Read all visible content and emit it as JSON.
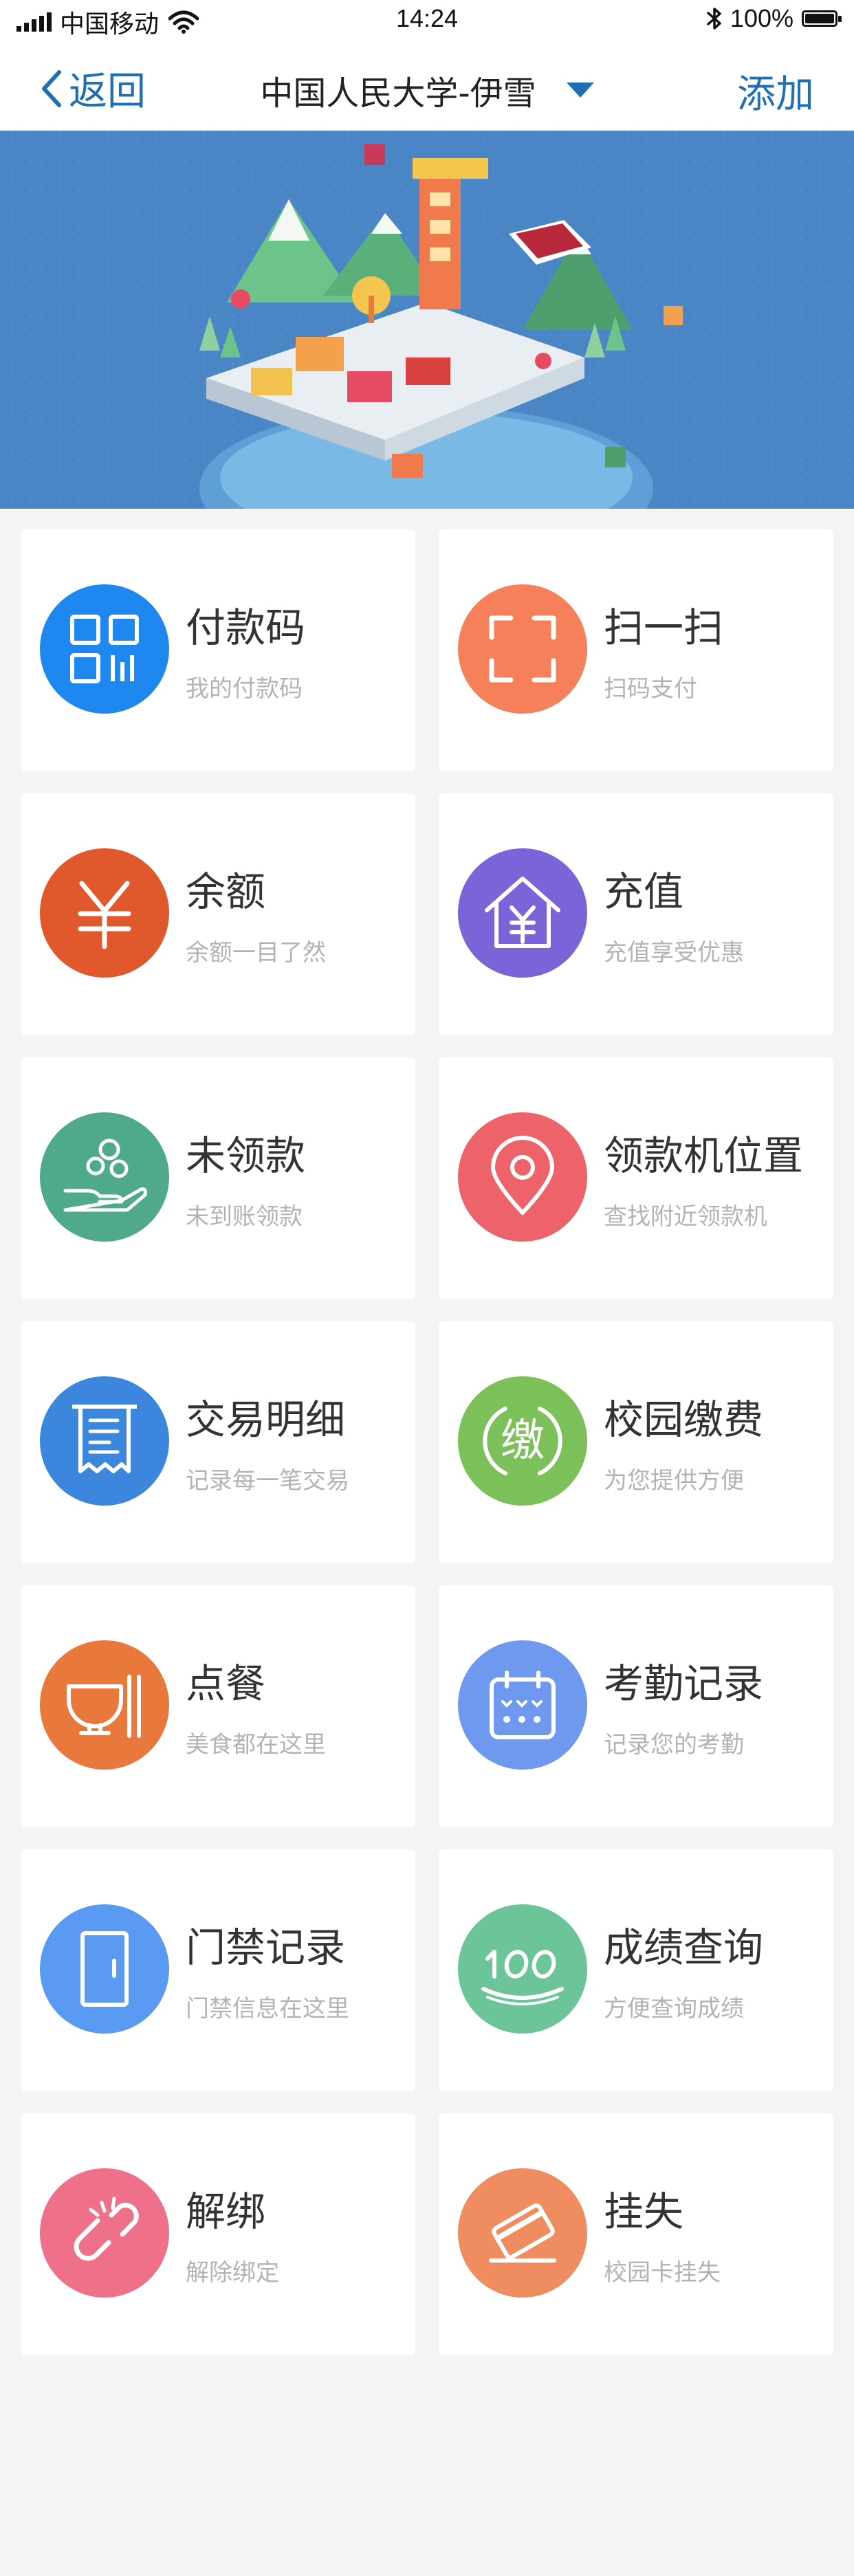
{
  "status_bar": {
    "carrier": "中国移动",
    "time": "14:24",
    "battery": "100%",
    "battery_level": 1.0
  },
  "nav": {
    "back_label": "返回",
    "title": "中国人民大学-伊雪",
    "add_label": "添加"
  },
  "colors": {
    "accent": "#1f6fb3",
    "banner_bg": "#4a86c6"
  },
  "services": [
    {
      "title": "付款码",
      "subtitle": "我的付款码",
      "icon": "qr-code-icon",
      "color": "#1e88f0"
    },
    {
      "title": "扫一扫",
      "subtitle": "扫码支付",
      "icon": "scan-icon",
      "color": "#f5805a"
    },
    {
      "title": "余额",
      "subtitle": "余额一目了然",
      "icon": "yuan-icon",
      "color": "#e1582c"
    },
    {
      "title": "充值",
      "subtitle": "充值享受优惠",
      "icon": "house-yuan-icon",
      "color": "#7b64d8"
    },
    {
      "title": "未领款",
      "subtitle": "未到账领款",
      "icon": "hand-coins-icon",
      "color": "#4fa98c"
    },
    {
      "title": "领款机位置",
      "subtitle": "查找附近领款机",
      "icon": "location-pin-icon",
      "color": "#ee636a"
    },
    {
      "title": "交易明细",
      "subtitle": "记录每一笔交易",
      "icon": "receipt-icon",
      "color": "#3d86de"
    },
    {
      "title": "校园缴费",
      "subtitle": "为您提供方便",
      "icon": "payment-icon",
      "color": "#7cc059"
    },
    {
      "title": "点餐",
      "subtitle": "美食都在这里",
      "icon": "bowl-icon",
      "color": "#e8783b"
    },
    {
      "title": "考勤记录",
      "subtitle": "记录您的考勤",
      "icon": "calendar-icon",
      "color": "#6f98ef"
    },
    {
      "title": "门禁记录",
      "subtitle": "门禁信息在这里",
      "icon": "door-icon",
      "color": "#5b9af2"
    },
    {
      "title": "成绩查询",
      "subtitle": "方便查询成绩",
      "icon": "score-100-icon",
      "color": "#6cc499"
    },
    {
      "title": "解绑",
      "subtitle": "解除绑定",
      "icon": "broken-link-icon",
      "color": "#ee7189"
    },
    {
      "title": "挂失",
      "subtitle": "校园卡挂失",
      "icon": "card-loss-icon",
      "color": "#ef8c60"
    }
  ]
}
